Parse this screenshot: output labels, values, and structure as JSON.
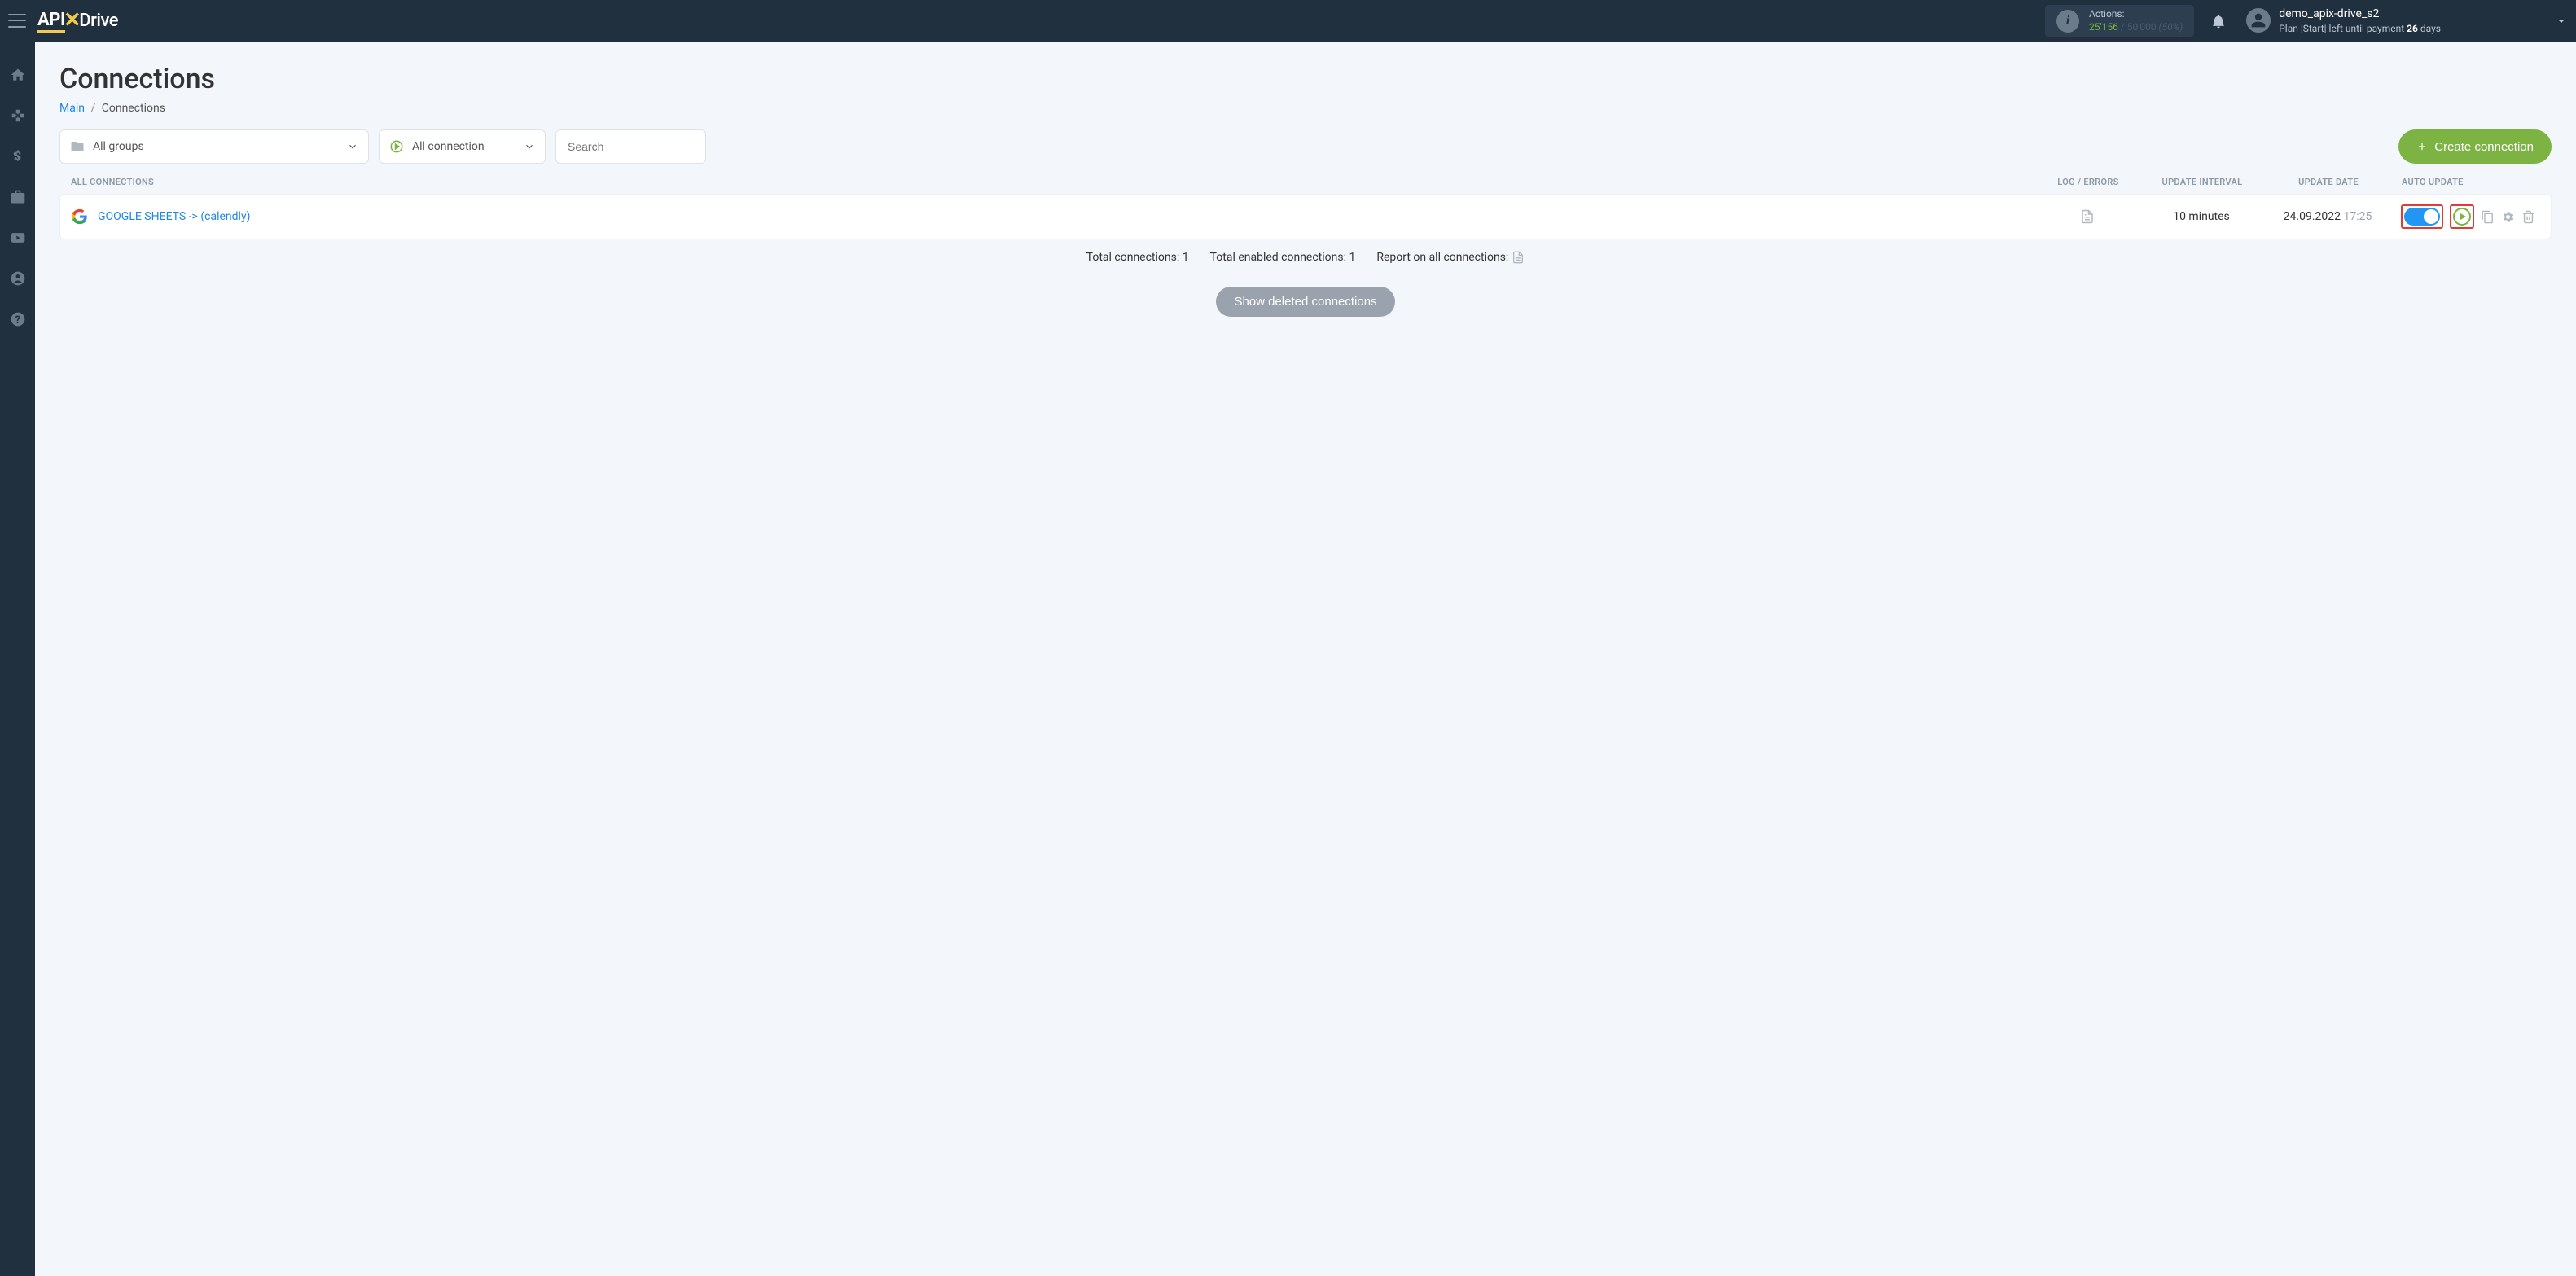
{
  "header": {
    "logo_api": "API",
    "logo_drive": "Drive",
    "actions_label": "Actions:",
    "actions_used": "25'156",
    "actions_sep": " / ",
    "actions_total": "50'000",
    "actions_pct": "(50%)",
    "user_name": "demo_apix-drive_s2",
    "plan_prefix": "Plan ",
    "plan_name": "|Start|",
    "plan_mid": " left until payment ",
    "plan_days": "26",
    "plan_days_suffix": " days"
  },
  "page": {
    "title": "Connections",
    "breadcrumb_main": "Main",
    "breadcrumb_current": "Connections"
  },
  "filters": {
    "groups_label": "All groups",
    "conn_label": "All connection",
    "search_placeholder": "Search",
    "create_label": "Create connection"
  },
  "table": {
    "head_all": "ALL CONNECTIONS",
    "head_log": "LOG / ERRORS",
    "head_interval": "UPDATE INTERVAL",
    "head_date": "UPDATE DATE",
    "head_auto": "AUTO UPDATE",
    "row": {
      "name": "GOOGLE SHEETS -> (calendly)",
      "interval": "10 minutes",
      "date": "24.09.2022",
      "time": "17:25"
    }
  },
  "summary": {
    "total": "Total connections: 1",
    "enabled": "Total enabled connections: 1",
    "report": "Report on all connections:"
  },
  "buttons": {
    "show_deleted": "Show deleted connections"
  }
}
